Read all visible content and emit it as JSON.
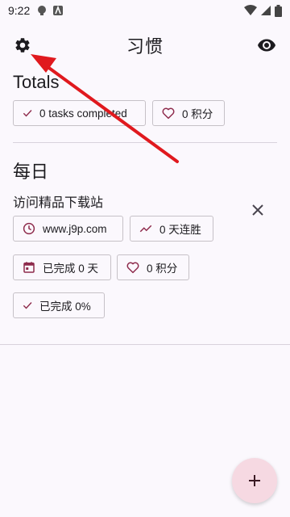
{
  "status_bar": {
    "time": "9:22"
  },
  "app_bar": {
    "title": "习惯"
  },
  "totals": {
    "title": "Totals",
    "tasks_completed": "0 tasks completed",
    "points": "0 积分"
  },
  "daily": {
    "title": "每日",
    "habit": {
      "name": "访问精品下载站",
      "url": "www.j9p.com",
      "streak": "0 天连胜",
      "completed_days": "已完成 0 天",
      "points": "0 积分",
      "completed_percent": "已完成 0%"
    }
  },
  "colors": {
    "accent": "#8e2b4c",
    "fab_bg": "#f6d9e2",
    "background": "#fbf8fd",
    "annotation_arrow": "#e0191e"
  },
  "icons": [
    "gear-icon",
    "eye-icon",
    "check-icon",
    "heart-icon",
    "clock-icon",
    "trend-icon",
    "calendar-icon",
    "close-icon",
    "plus-icon"
  ]
}
